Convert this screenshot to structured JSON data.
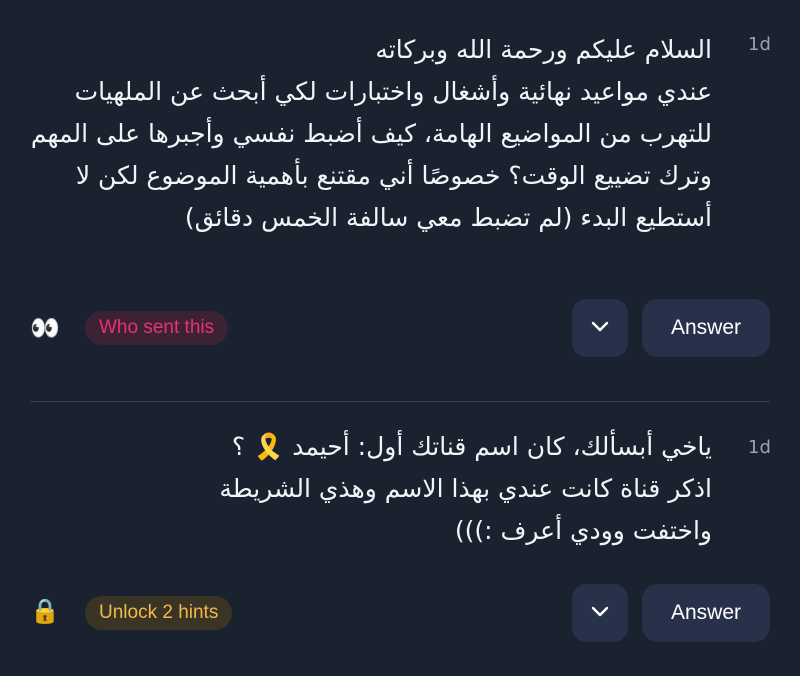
{
  "questions": [
    {
      "text": "السلام عليكم ورحمة الله وبركاته\nعندي مواعيد نهائية وأشغال واختبارات لكي أبحث عن الملهيات للتهرب من المواضيع الهامة، كيف أضبط نفسي وأجبرها على المهم وترك تضييع الوقت؟ خصوصًا أني مقتنع بأهمية الموضوع لكن لا أستطيع البدء (لم تضبط معي سالفة الخمس دقائق)",
      "time": "1d",
      "reaction_emoji": "👀",
      "pill_label": "Who sent this",
      "pill_color": "#e8326f",
      "answer_label": "Answer"
    },
    {
      "text": "ياخي أبسألك، كان اسم قناتك أول: أحيمد 🎗️ ؟\nاذكر قناة كانت عندي بهذا الاسم وهذي الشريطة\nواختفت وودي أعرف :)))",
      "time": "1d",
      "reaction_emoji": "🔒",
      "pill_label": "Unlock 2 hints",
      "pill_color": "#f2b94a",
      "answer_label": "Answer"
    }
  ],
  "icons": {
    "chevron": "chevron-down-icon",
    "eyes": "eyes-icon",
    "lock": "lock-icon"
  },
  "colors": {
    "background": "#1a2230",
    "button": "#27324a",
    "divider": "#384252"
  }
}
